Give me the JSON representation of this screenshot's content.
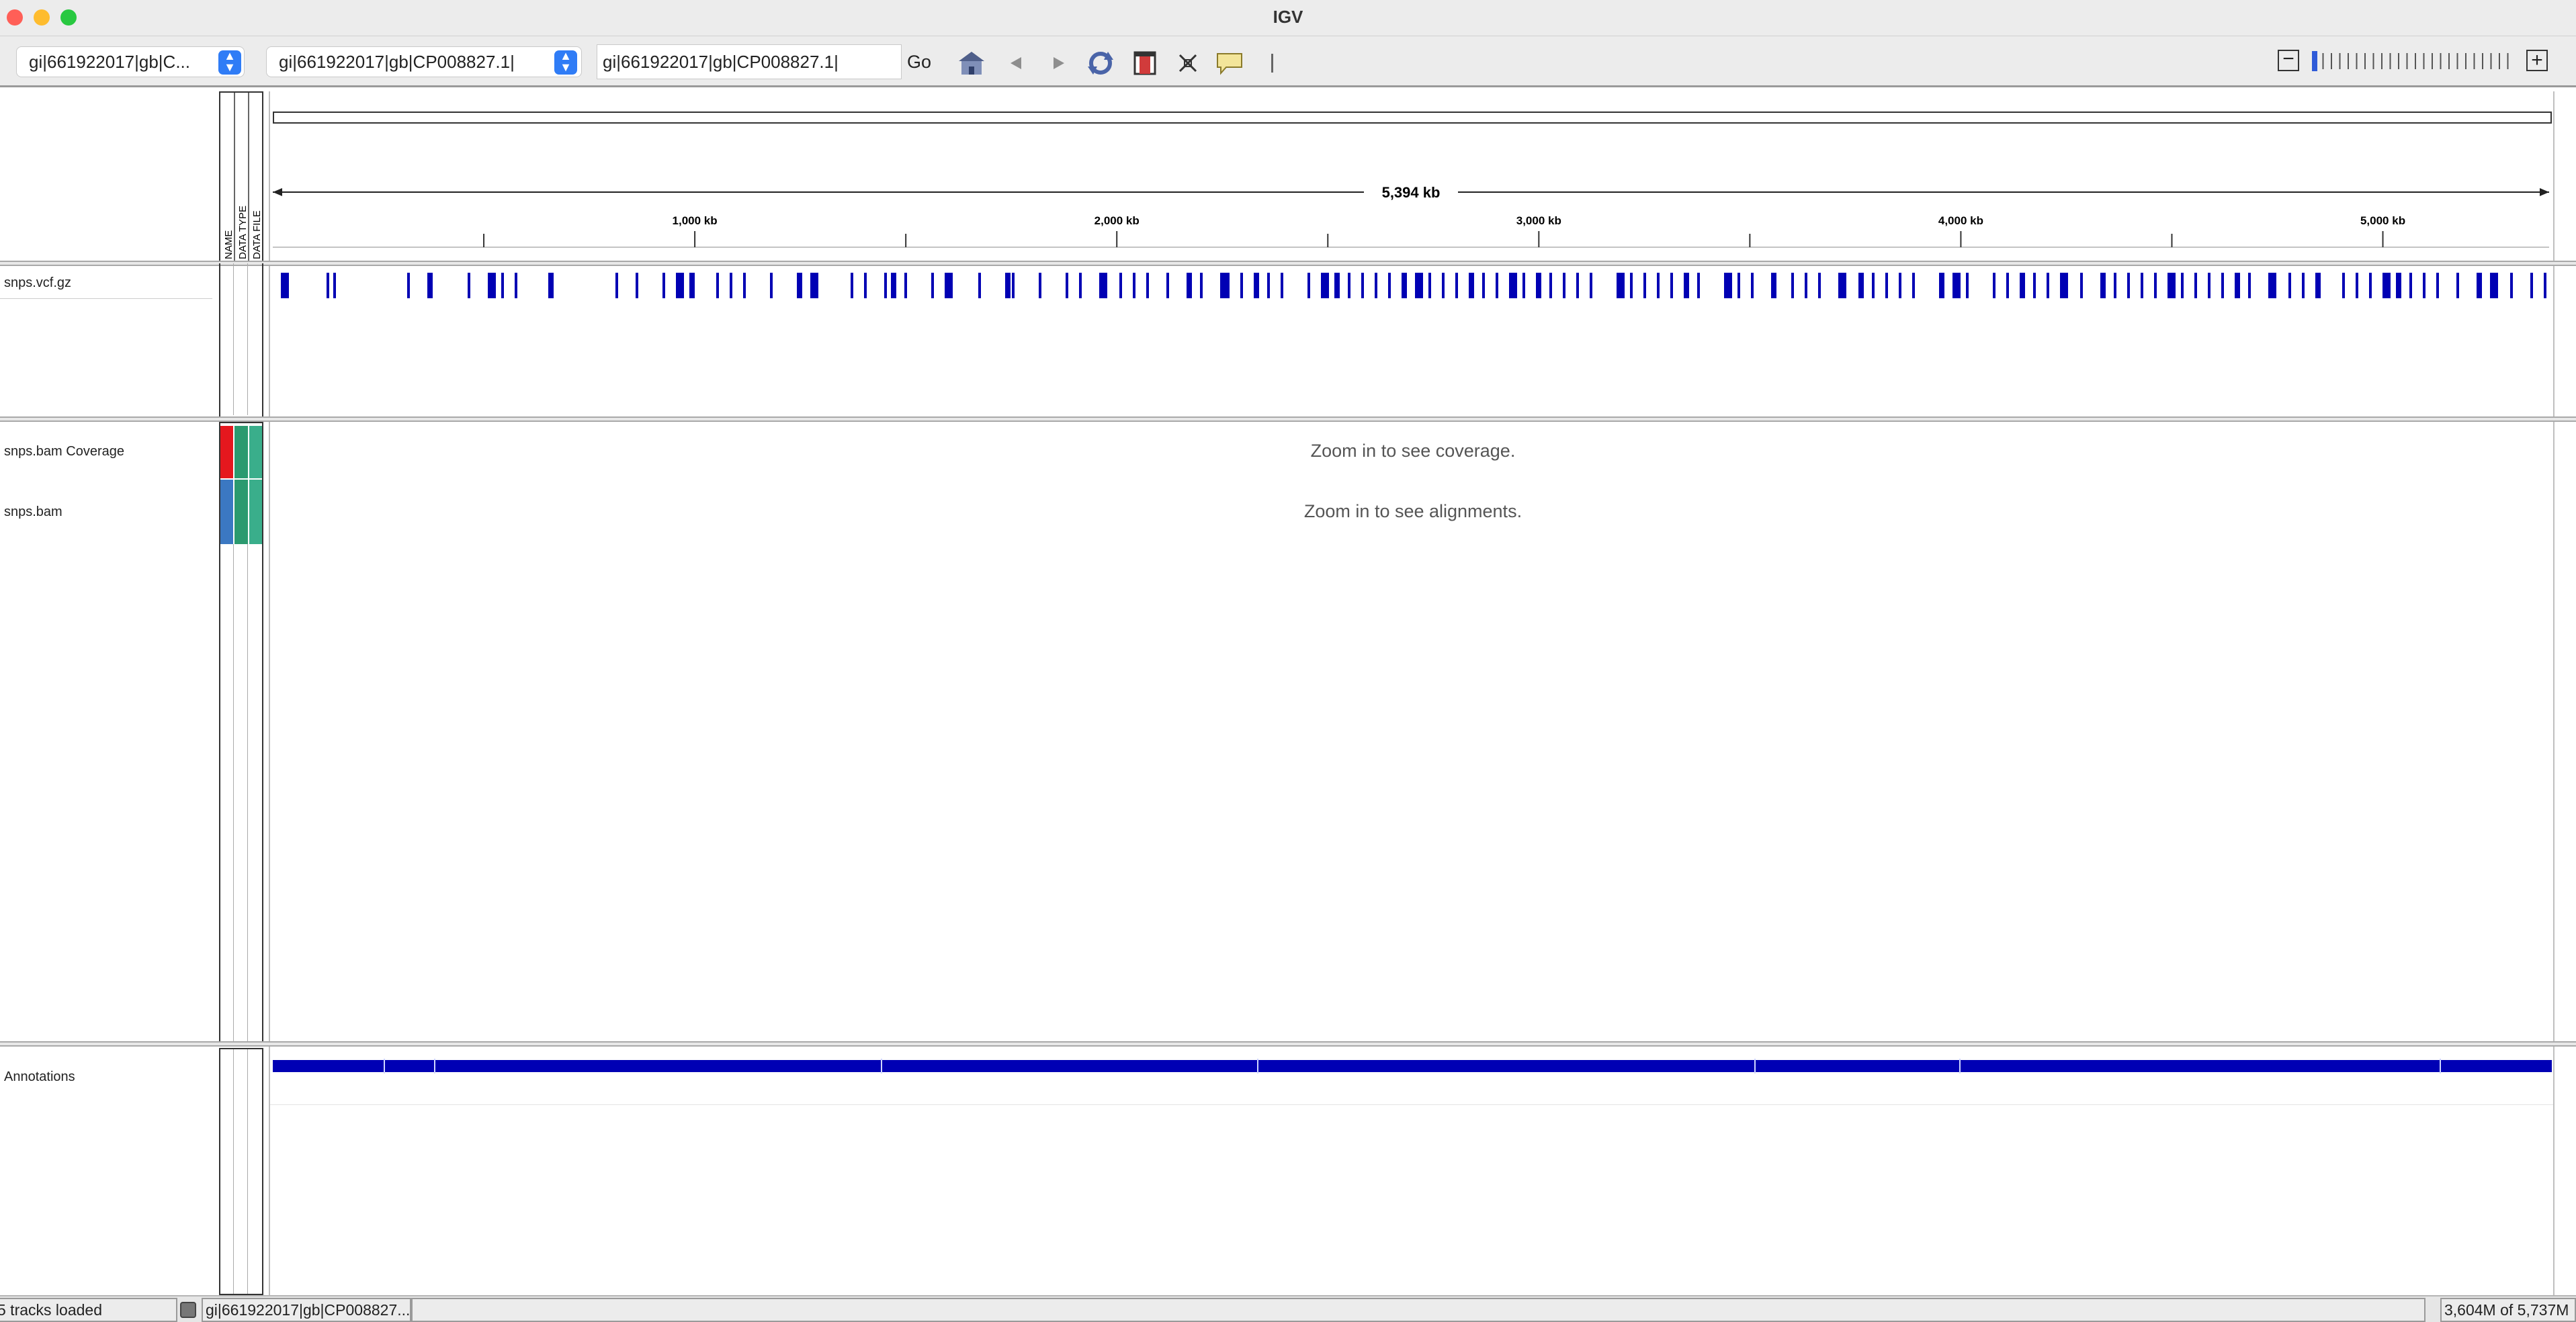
{
  "window": {
    "title": "IGV"
  },
  "toolbar": {
    "genome_select": "gi|661922017|gb|C...",
    "chromosome_select": "gi|661922017|gb|CP008827.1|",
    "locus_input": "gi|661922017|gb|CP008827.1|",
    "go_label": "Go",
    "icons": [
      "home-icon",
      "back-icon",
      "forward-icon",
      "refresh-icon",
      "region-of-interest-icon",
      "fit-to-window-icon",
      "popup-text-icon",
      "ruler-toggle-icon",
      "zoom-out-icon",
      "zoom-slider",
      "zoom-in-icon"
    ],
    "zoom_level": 0
  },
  "attribute_headers": [
    "NAME",
    "DATA TYPE",
    "DATA FILE"
  ],
  "ruler": {
    "span_label": "5,394 kb",
    "ticks": [
      {
        "label": "1,000 kb",
        "kb": 1000
      },
      {
        "label": "2,000 kb",
        "kb": 2000
      },
      {
        "label": "3,000 kb",
        "kb": 3000
      },
      {
        "label": "4,000 kb",
        "kb": 4000
      },
      {
        "label": "5,000 kb",
        "kb": 5000
      }
    ],
    "minor_ticks_kb": [
      500,
      1500,
      2500,
      3500,
      4500
    ],
    "total_kb": 5394
  },
  "tracks": {
    "vcf": {
      "name": "snps.vcf.gz",
      "color": "#0000b4"
    },
    "coverage": {
      "name": "snps.bam Coverage",
      "message": "Zoom in to see coverage.",
      "attr_colors": [
        "#e5171e",
        "#2b9a6f",
        "#3aae8b"
      ]
    },
    "alignments": {
      "name": "snps.bam",
      "message": "Zoom in to see alignments.",
      "attr_colors": [
        "#3b78c2",
        "#2b9a6f",
        "#3aae8b"
      ]
    },
    "annotations": {
      "name": "Annotations",
      "color": "#0000b4"
    }
  },
  "status": {
    "tracks_loaded": "5 tracks loaded",
    "current_chr": "gi|661922017|gb|CP008827....",
    "memory": "3,604M of 5,737M"
  }
}
